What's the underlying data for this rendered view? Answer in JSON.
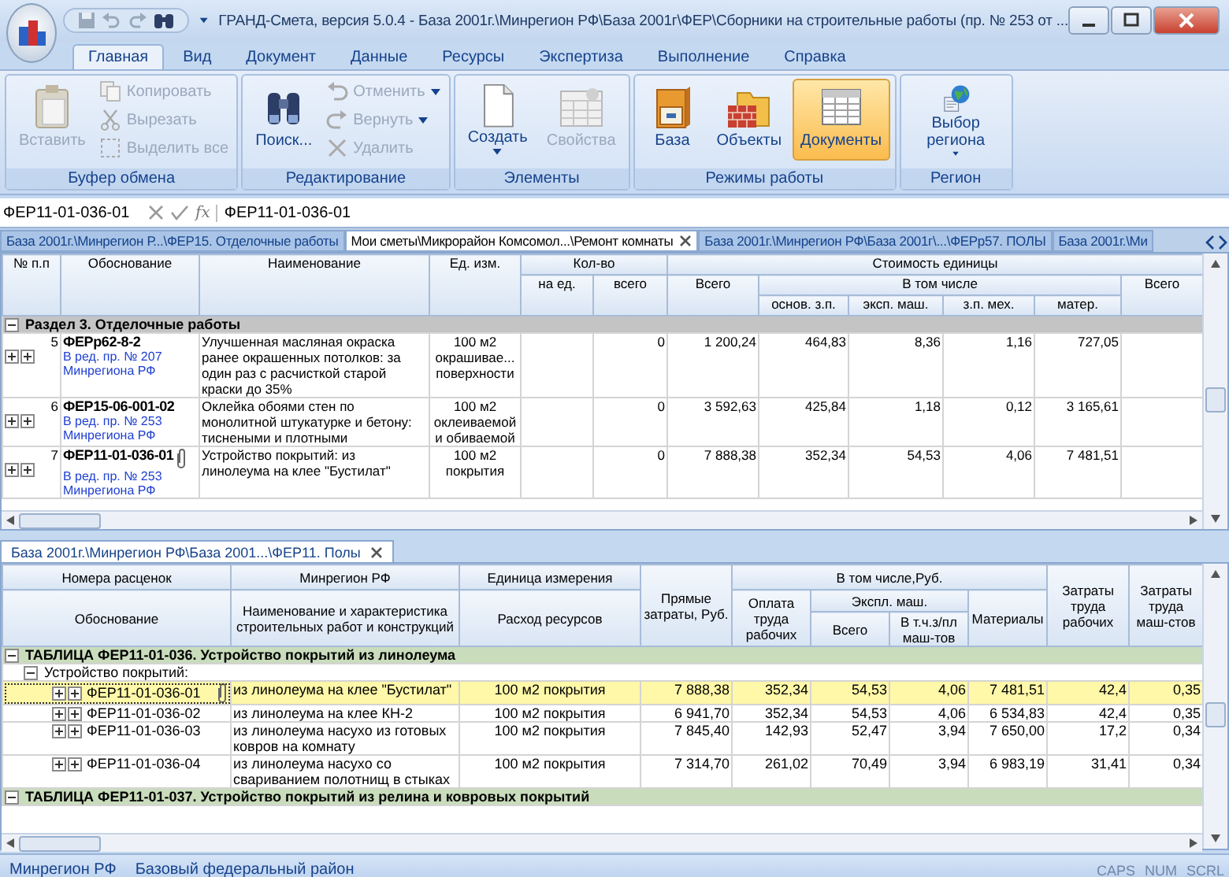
{
  "window": {
    "title": "ГРАНД-Смета, версия 5.0.4 - База 2001г.\\Минрегион РФ\\База 2001г\\ФЕР\\Сборники на строительные работы (пр. № 253 от ..."
  },
  "ribbon": {
    "tabs": [
      {
        "label": "Главная",
        "selected": true
      },
      {
        "label": "Вид",
        "selected": false
      },
      {
        "label": "Документ",
        "selected": false
      },
      {
        "label": "Данные",
        "selected": false
      },
      {
        "label": "Ресурсы",
        "selected": false
      },
      {
        "label": "Экспертиза",
        "selected": false
      },
      {
        "label": "Выполнение",
        "selected": false
      },
      {
        "label": "Справка",
        "selected": false
      }
    ],
    "groups": [
      {
        "label": "Буфер обмена",
        "items": [
          {
            "kind": "large",
            "label": "Вставить",
            "disabled": true,
            "dropdown": false,
            "selected": false
          },
          {
            "kind": "small",
            "label": "Копировать",
            "disabled": true,
            "dropdown": false
          },
          {
            "kind": "small",
            "label": "Вырезать",
            "disabled": true,
            "dropdown": false
          },
          {
            "kind": "small",
            "label": "Выделить все",
            "disabled": true,
            "dropdown": false
          }
        ]
      },
      {
        "label": "Редактирование",
        "items": [
          {
            "kind": "large",
            "label": "Поиск...",
            "disabled": false,
            "dropdown": false,
            "selected": false
          },
          {
            "kind": "small",
            "label": "Отменить",
            "disabled": true,
            "dropdown": true
          },
          {
            "kind": "small",
            "label": "Вернуть",
            "disabled": true,
            "dropdown": true
          },
          {
            "kind": "small",
            "label": "Удалить",
            "disabled": true,
            "dropdown": false
          }
        ]
      },
      {
        "label": "Элементы",
        "items": [
          {
            "kind": "large",
            "label": "Создать",
            "disabled": false,
            "dropdown": true,
            "selected": false
          },
          {
            "kind": "large",
            "label": "Свойства",
            "disabled": true,
            "dropdown": false,
            "selected": false
          }
        ]
      },
      {
        "label": "Режимы работы",
        "items": [
          {
            "kind": "large",
            "label": "База",
            "disabled": false,
            "dropdown": false,
            "selected": false
          },
          {
            "kind": "large",
            "label": "Объекты",
            "disabled": false,
            "dropdown": false,
            "selected": false
          },
          {
            "kind": "large",
            "label": "Документы",
            "disabled": false,
            "dropdown": false,
            "selected": true
          }
        ]
      },
      {
        "label": "Регион",
        "items": [
          {
            "kind": "large",
            "label": "Выбор региона",
            "disabled": false,
            "dropdown": true,
            "selected": false
          }
        ]
      }
    ]
  },
  "formula_bar": {
    "name_box": "ФЕР11-01-036-01",
    "function_label": "fx",
    "value": "ФЕР11-01-036-01"
  },
  "document_tabs": [
    {
      "label": "База 2001г.\\Минрегион Р...\\ФЕР15. Отделочные работы",
      "selected": false,
      "closable": false
    },
    {
      "label": "Мои сметы\\Микрорайон Комсомол...\\Ремонт комнаты",
      "selected": true,
      "closable": true
    },
    {
      "label": "База 2001г.\\Минрегион РФ\\База 2001г\\...\\ФЕРр57. ПОЛЫ",
      "selected": false,
      "closable": false
    },
    {
      "label": "База 2001г.\\Ми",
      "selected": false,
      "closable": false
    }
  ],
  "estimate_grid": {
    "headers": {
      "number": "№ п.п",
      "basis": "Обоснование",
      "name": "Наименование",
      "unit": "Ед. изм.",
      "quantity": "Кол-во",
      "per_unit": "на ед.",
      "quantity_total": "всего",
      "unit_cost": "Стоимость единицы",
      "cost_total": "Всего",
      "including": "В том числе",
      "base_wage": "основ. з.п.",
      "machines": "эксп. маш.",
      "mech_wage": "з.п. мех.",
      "materials": "матер.",
      "total": "Всего"
    },
    "section": {
      "title": "Раздел 3. Отделочные работы",
      "expanded": true
    },
    "rows": [
      {
        "number": "5",
        "code": "ФЕРр62-8-2",
        "notes": [
          "В ред. пр. № 207",
          "Минрегиона РФ"
        ],
        "attachment": false,
        "name": "Улучшенная масляная окраска ранее окрашенных потолков: за один раз с расчисткой старой краски до 35%",
        "unit": "100 м2 окрашивае... поверхности",
        "quantity_total": "0",
        "cost_total": "1 200,24",
        "base_wage": "464,83",
        "machines": "8,36",
        "mech_wage": "1,16",
        "materials": "727,05"
      },
      {
        "number": "6",
        "code": "ФЕР15-06-001-02",
        "notes": [
          "В ред. пр. № 253",
          "Минрегиона РФ"
        ],
        "attachment": false,
        "name": "Оклейка обоями стен по монолитной штукатурке и бетону: тиснеными и плотными",
        "unit": "100 м2 оклеиваемой и обиваемой",
        "quantity_total": "0",
        "cost_total": "3 592,63",
        "base_wage": "425,84",
        "machines": "1,18",
        "mech_wage": "0,12",
        "materials": "3 165,61"
      },
      {
        "number": "7",
        "code": "ФЕР11-01-036-01",
        "notes": [
          "В ред. пр. № 253",
          "Минрегиона РФ"
        ],
        "attachment": true,
        "name": "Устройство покрытий: из линолеума на клее \"Бустилат\"",
        "unit": "100 м2 покрытия",
        "quantity_total": "0",
        "cost_total": "7 888,38",
        "base_wage": "352,34",
        "machines": "54,53",
        "mech_wage": "4,06",
        "materials": "7 481,51"
      }
    ]
  },
  "base_tab": {
    "label": "База 2001г.\\Минрегион РФ\\База 2001...\\ФЕР11. Полы",
    "closable": true
  },
  "rates_grid": {
    "headers": {
      "rate_numbers": "Номера расценок",
      "region": "Минрегион РФ",
      "unit": "Единица измерения",
      "direct": "Прямые затраты, Руб.",
      "including": "В том числе,Руб.",
      "labor_workers": "Затраты труда рабочих",
      "labor_machinists": "Затраты труда маш-стов",
      "basis": "Обоснование",
      "name": "Наименование и характеристика строительных работ и конструкций",
      "resources": "Расход ресурсов",
      "wage": "Оплата труда рабочих",
      "machines": "Экспл. маш.",
      "materials": "Материалы",
      "machines_total": "Всего",
      "machine_wage": "В т.ч.з/пл маш-тов"
    },
    "tables": [
      {
        "title": "ТАБЛИЦА ФЕР11-01-036. Устройство покрытий из линолеума",
        "expanded": true,
        "groups": [
          {
            "title": "Устройство покрытий:",
            "expanded": true,
            "rows": [
              {
                "code": "ФЕР11-01-036-01",
                "selected": true,
                "attachment": true,
                "name": "из линолеума на клее \"Бустилат\"",
                "unit": "100 м2 покрытия",
                "direct": "7 888,38",
                "wage": "352,34",
                "machines_total": "54,53",
                "machine_wage": "4,06",
                "materials": "7 481,51",
                "labor_workers": "42,4",
                "labor_machinists": "0,35"
              },
              {
                "code": "ФЕР11-01-036-02",
                "selected": false,
                "attachment": false,
                "name": "из линолеума на клее КН-2",
                "unit": "100 м2 покрытия",
                "direct": "6 941,70",
                "wage": "352,34",
                "machines_total": "54,53",
                "machine_wage": "4,06",
                "materials": "6 534,83",
                "labor_workers": "42,4",
                "labor_machinists": "0,35"
              },
              {
                "code": "ФЕР11-01-036-03",
                "selected": false,
                "attachment": false,
                "name": "из линолеума насухо из готовых ковров на комнату",
                "unit": "100 м2 покрытия",
                "direct": "7 845,40",
                "wage": "142,93",
                "machines_total": "52,47",
                "machine_wage": "3,94",
                "materials": "7 650,00",
                "labor_workers": "17,2",
                "labor_machinists": "0,34"
              },
              {
                "code": "ФЕР11-01-036-04",
                "selected": false,
                "attachment": false,
                "name": "из линолеума насухо со свариванием полотнищ в стыках",
                "unit": "100 м2 покрытия",
                "direct": "7 314,70",
                "wage": "261,02",
                "machines_total": "70,49",
                "machine_wage": "3,94",
                "materials": "6 983,19",
                "labor_workers": "31,41",
                "labor_machinists": "0,34"
              }
            ]
          }
        ]
      },
      {
        "title": "ТАБЛИЦА ФЕР11-01-037. Устройство покрытий из релина и ковровых покрытий",
        "expanded": true
      }
    ]
  },
  "status_bar": {
    "items": [
      "Минрегион РФ",
      "Базовый федеральный район"
    ],
    "indicators": [
      {
        "label": "CAPS",
        "on": false
      },
      {
        "label": "NUM",
        "on": false
      },
      {
        "label": "SCRL",
        "on": false
      }
    ]
  }
}
